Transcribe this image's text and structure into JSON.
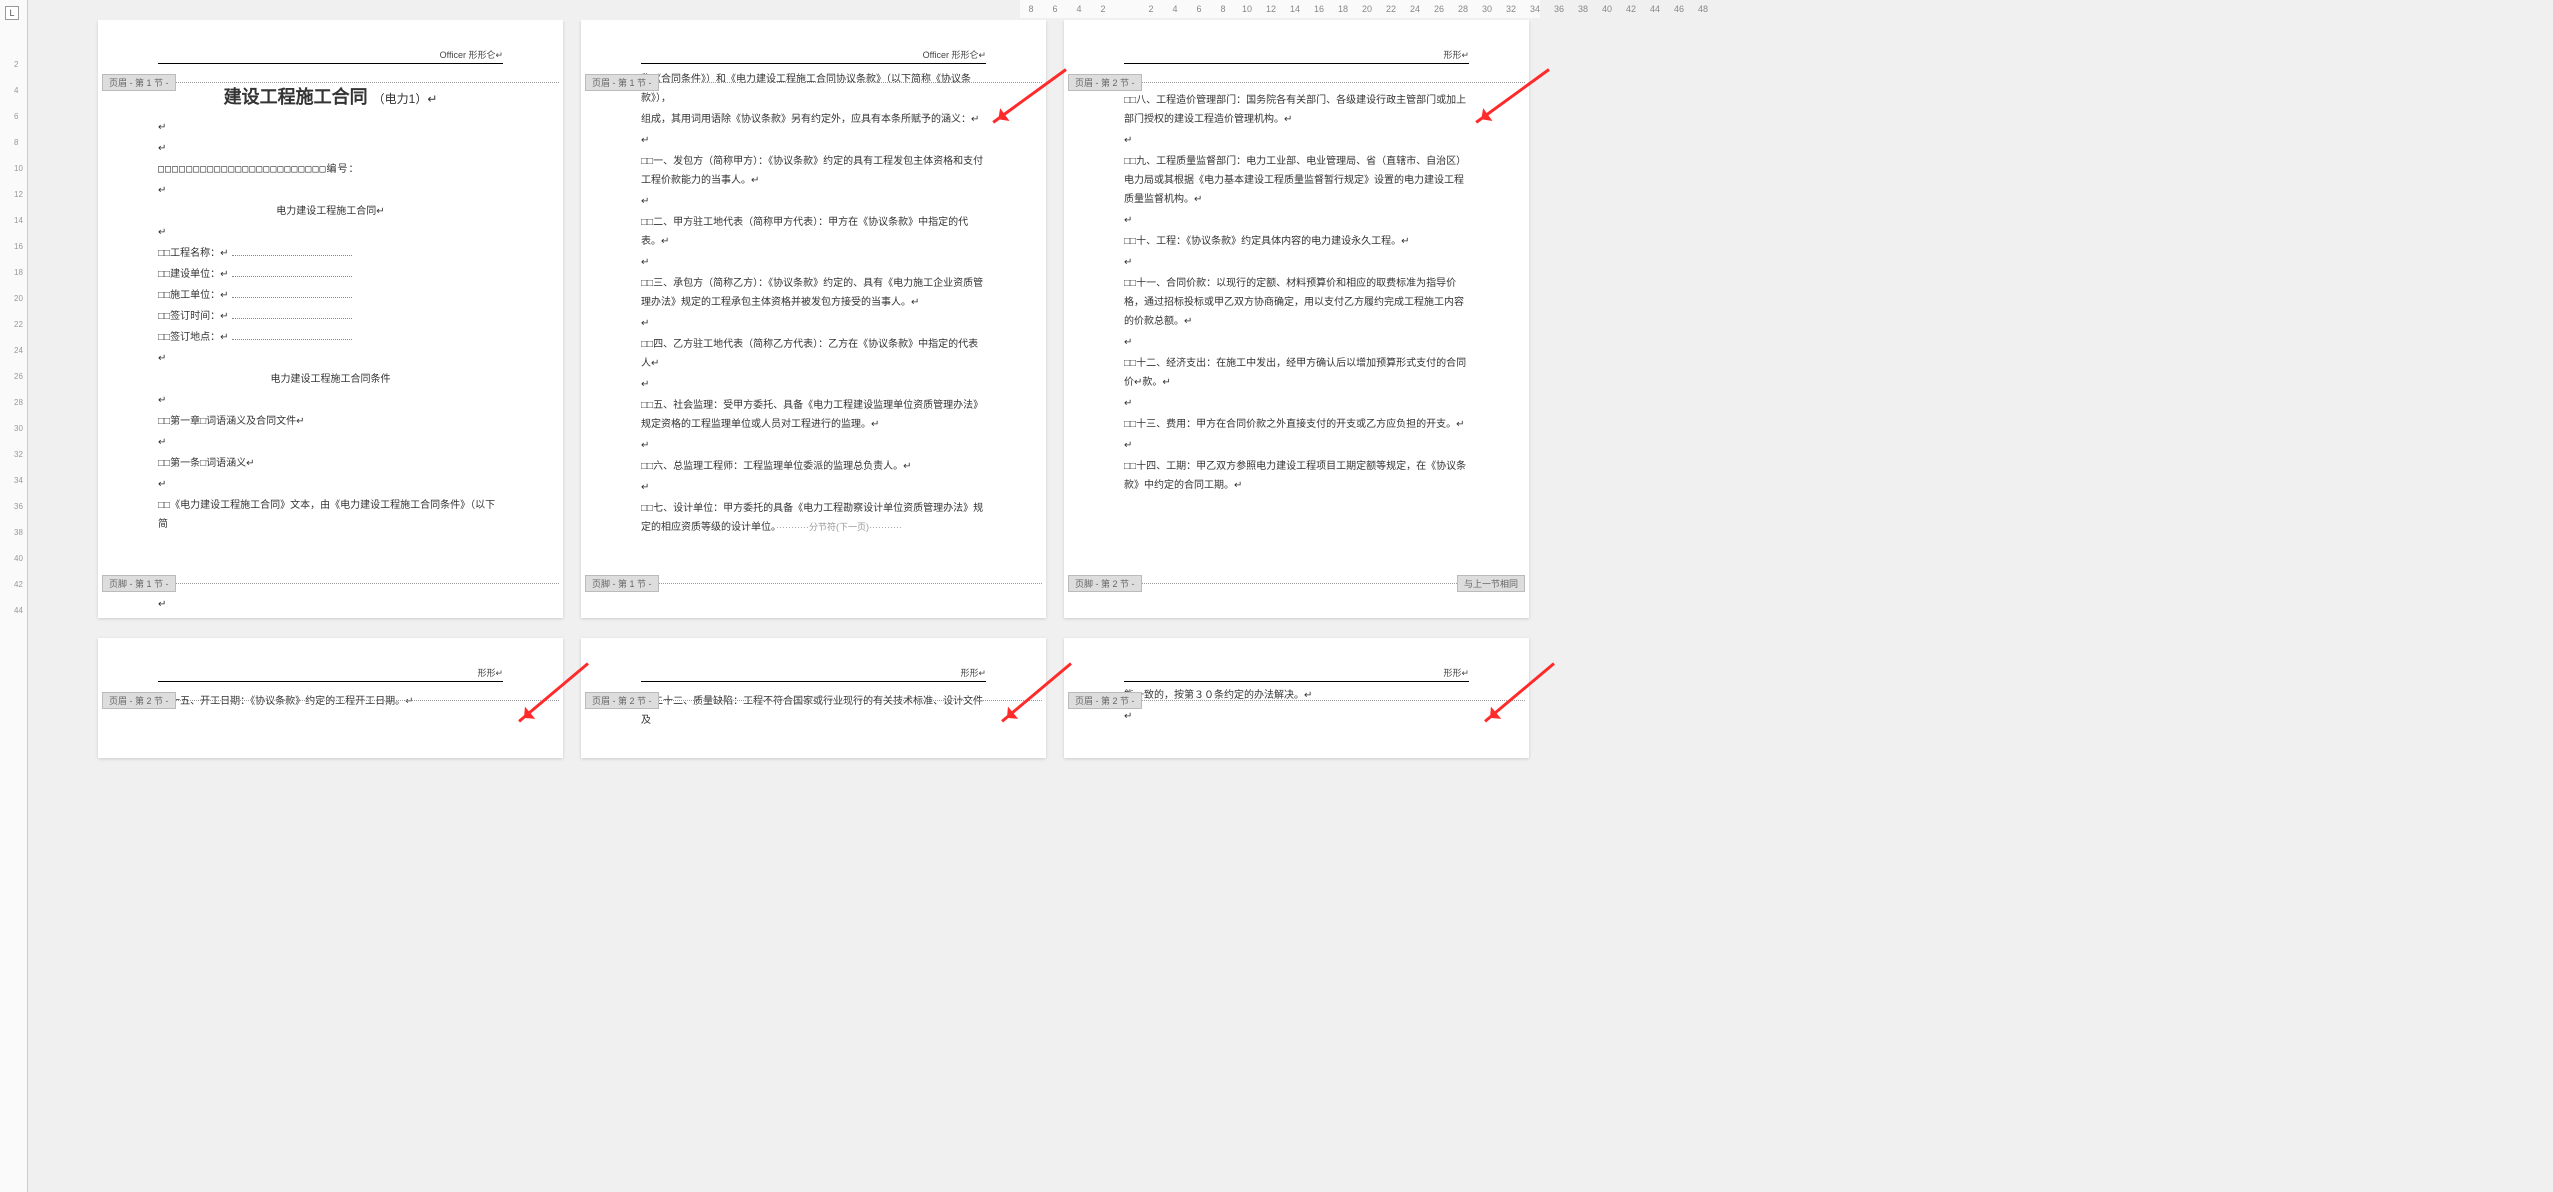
{
  "ruler_v": {
    "tab_stop_label": "L",
    "ticks": [
      "2",
      "4",
      "6",
      "8",
      "10",
      "12",
      "14",
      "16",
      "18",
      "20",
      "22",
      "24",
      "26",
      "28",
      "30",
      "32",
      "34",
      "36",
      "38",
      "40",
      "42",
      "44"
    ]
  },
  "ruler_h": {
    "values": [
      "8",
      "6",
      "4",
      "2",
      "",
      "2",
      "4",
      "6",
      "8",
      "10",
      "12",
      "14",
      "16",
      "18",
      "20",
      "22",
      "24",
      "26",
      "28",
      "30",
      "32",
      "34",
      "36",
      "38",
      "40",
      "42",
      "44",
      "46",
      "48"
    ]
  },
  "tags": {
    "header_s1": "页眉 - 第 1 节 -",
    "footer_s1": "页脚 - 第 1 节 -",
    "header_s2": "页眉 - 第 2 节 -",
    "footer_s2": "页脚 - 第 2 节 -",
    "same_as_prev": "与上一节相同"
  },
  "headers": {
    "officer": "Officer 形形仑↵",
    "short": "形形↵"
  },
  "footer": {
    "section_break": "···········分节符(下一页)···········"
  },
  "page1": {
    "title_main": "建设工程施工合同",
    "title_sub": "（电力1）↵",
    "blank1": "↵",
    "blank2": "↵",
    "boxes_line": "□□□□□□□□□□□□□□□□□□□□□□□□编号：",
    "blank3": "↵",
    "subtitle1": "电力建设工程施工合同↵",
    "blank4": "↵",
    "f1": "□□工程名称：",
    "f2": "□□建设单位：",
    "f3": "□□施工单位：",
    "f4": "□□签订时间：",
    "f5": "□□签订地点：",
    "blank5": "↵",
    "subtitle2": "电力建设工程施工合同条件",
    "blank6": "↵",
    "chap": "□□第一章□词语涵义及合同文件↵",
    "blank7": "↵",
    "art1": "□□第一条□词语涵义↵",
    "blank8": "↵",
    "tail": "□□《电力建设工程施工合同》文本，由《电力建设工程施工合同条件》（以下简",
    "blank9": "↵"
  },
  "page2": {
    "l1": "称《合同条件》）和《电力建设工程施工合同协议条款》（以下简称《协议条款》），",
    "l1b": "组成，其用词用语除《协议条款》另有约定外，应具有本条所赋予的涵义：↵",
    "l1c": "↵",
    "l2": "□□一、发包方（简称甲方）：《协议条款》约定的具有工程发包主体资格和支付工程价款能力的当事人。↵",
    "l2b": "↵",
    "l3": "□□二、甲方驻工地代表（简称甲方代表）：甲方在《协议条款》中指定的代表。↵",
    "l3b": "↵",
    "l4": "□□三、承包方（简称乙方）：《协议条款》约定的、具有《电力施工企业资质管理办法》规定的工程承包主体资格并被发包方接受的当事人。↵",
    "l4b": "↵",
    "l5": "□□四、乙方驻工地代表（简称乙方代表）：乙方在《协议条款》中指定的代表人↵",
    "l5b": "↵",
    "l6": "□□五、社会监理：受甲方委托、具备《电力工程建设监理单位资质管理办法》规定资格的工程监理单位或人员对工程进行的监理。↵",
    "l6b": "↵",
    "l7": "□□六、总监理工程师：工程监理单位委派的监理总负责人。↵",
    "l7b": "↵",
    "l8": "□□七、设计单位：甲方委托的具备《电力工程勘察设计单位资质管理办法》规定的相应资质等级的设计单位。"
  },
  "page3": {
    "l0": "↵",
    "l1": "□□八、工程造价管理部门：国务院各有关部门、各级建设行政主管部门或加上部门授权的建设工程造价管理机构。↵",
    "l1b": "↵",
    "l2": "□□九、工程质量监督部门：电力工业部、电业管理局、省（直辖市、自治区）电力局或其根据《电力基本建设工程质量监督暂行规定》设置的电力建设工程质量监督机构。↵",
    "l2b": "↵",
    "l3": "□□十、工程：《协议条款》约定具体内容的电力建设永久工程。↵",
    "l3b": "↵",
    "l4": "□□十一、合同价款：以现行的定额、材料预算价和相应的取费标准为指导价格，通过招标投标或甲乙双方协商确定，用以支付乙方履约完成工程施工内容的价款总额。↵",
    "l4b": "↵",
    "l5": "□□十二、经济支出：在施工中发出，经甲方确认后以增加预算形式支付的合同价↵款。↵",
    "l5b": "↵",
    "l6": "□□十三、费用：甲方在合同价款之外直接支付的开支或乙方应负担的开支。↵",
    "l6b": "↵",
    "l7": "□□十四、工期：甲乙双方参照电力建设工程项目工期定额等规定，在《协议条款》中约定的合同工期。↵"
  },
  "page4": {
    "l1": "□□十五、开工日期：《协议条款》约定的工程开工日期。↵"
  },
  "page5": {
    "l1": "□□二十二、质量缺陷：工程不符合国家或行业现行的有关技术标准、设计文件及"
  },
  "page6": {
    "l1": "能一致的，按第３０条约定的办法解决。↵",
    "l1b": "↵"
  }
}
